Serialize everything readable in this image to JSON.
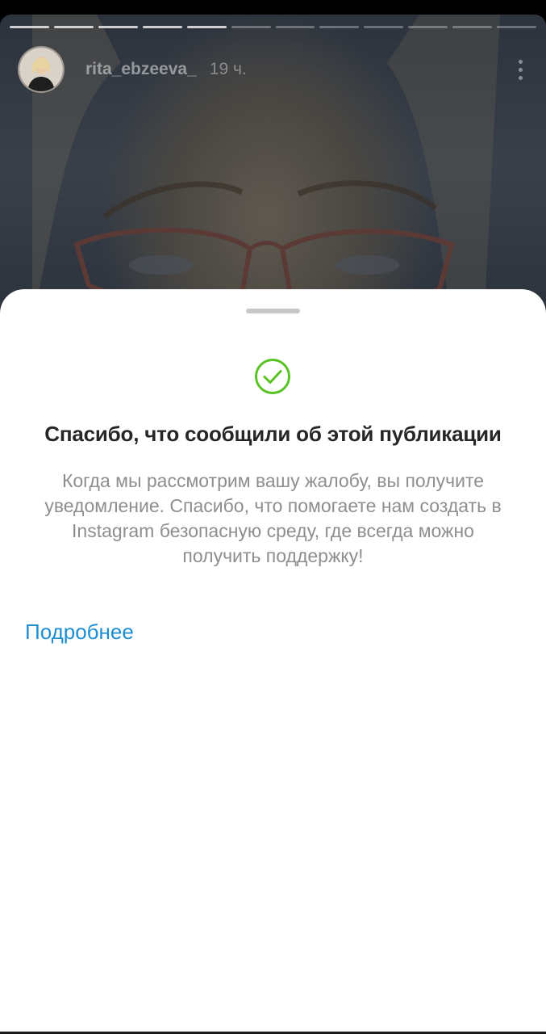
{
  "story": {
    "username": "rita_ebzeeva_",
    "time": "19 ч.",
    "progress_total": 12,
    "progress_completed": 5
  },
  "sheet": {
    "title": "Спасибо, что сообщили об этой публикации",
    "description": "Когда мы рассмотрим вашу жалобу, вы получите уведомление. Спасибо, что помогаете нам создать в Instagram безопасную среду, где всегда можно получить поддержку!",
    "learn_more": "Подробнее"
  },
  "colors": {
    "check": "#58c322",
    "link": "#1d8ed1",
    "title": "#262626",
    "description": "#8e8e8e"
  },
  "icons": [
    "checkmark-circle-icon",
    "more-vertical-icon"
  ]
}
